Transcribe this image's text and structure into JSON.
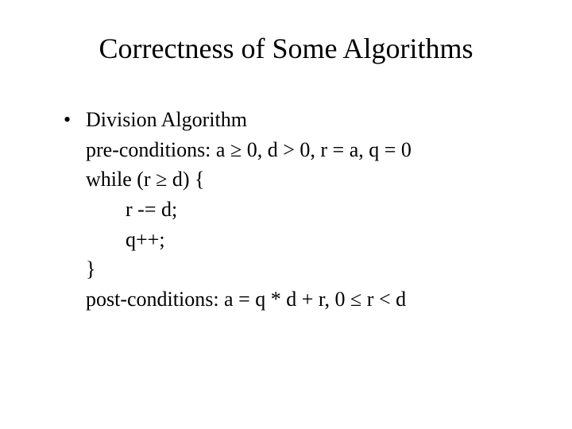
{
  "slide": {
    "title": "Correctness of Some Algorithms",
    "bullet_heading": "Division Algorithm",
    "lines": {
      "pre": "pre-conditions: a ≥ 0, d > 0, r = a, q = 0",
      "while": "while (r ≥ d) {",
      "r_minus": "r -= d;",
      "q_plus": "q++;",
      "close": "}",
      "post": "post-conditions: a = q * d + r, 0 ≤ r < d"
    }
  }
}
